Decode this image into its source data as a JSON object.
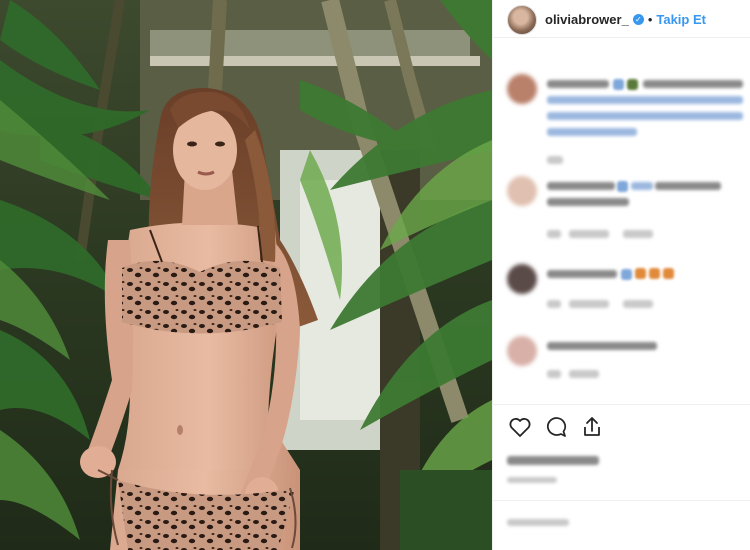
{
  "header": {
    "username": "oliviabrower_",
    "separator": "•",
    "follow_label": "Takip Et"
  },
  "colors": {
    "link_blue": "#3897f0",
    "verified_blue": "#3897f0",
    "border": "#efefef"
  },
  "icons": {
    "like": "heart-icon",
    "comment": "comment-icon",
    "share": "share-icon",
    "verified": "verified-badge-icon"
  }
}
